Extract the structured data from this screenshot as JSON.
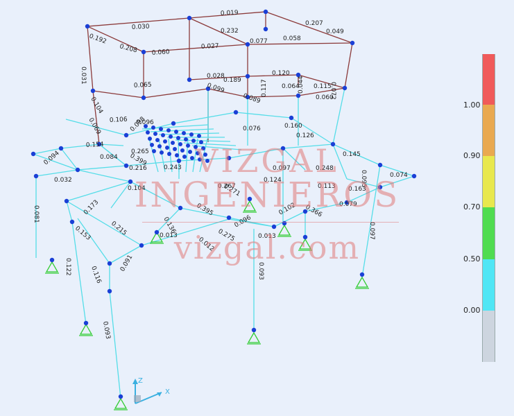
{
  "watermark": {
    "line1": "VIZGAL",
    "line2": "INGENIEROS",
    "line3": "vizgal.com"
  },
  "axes": {
    "z_label": "Z",
    "x_label": "X"
  },
  "legend": {
    "ticks": [
      "1.00",
      "0.90",
      "0.70",
      "0.50",
      "0.00"
    ],
    "band_colors": [
      "#f05a5a",
      "#e9a950",
      "#e8e84e",
      "#50dc50",
      "#4fe6f5",
      "#cdd5df"
    ]
  },
  "member_labels": [
    "0.030",
    "0.019",
    "0.192",
    "0.208",
    "0.060",
    "0.027",
    "0.232",
    "0.077",
    "0.058",
    "0.207",
    "0.049",
    "0.031",
    "0.065",
    "0.028",
    "0.099",
    "0.189",
    "0.089",
    "0.120",
    "0.064",
    "0.115",
    "0.072",
    "0.060",
    "0.117",
    "0.044",
    "0.104",
    "0.069",
    "0.106",
    "0.098",
    "0.096",
    "0.126",
    "0.154",
    "0.084",
    "0.216",
    "0.160",
    "0.097",
    "0.248",
    "0.145",
    "0.074",
    "0.104",
    "0.267",
    "0.124",
    "0.113",
    "0.163",
    "0.079",
    "0.095",
    "0.032",
    "0.094",
    "0.076",
    "0.173",
    "0.265",
    "0.399",
    "0.243",
    "0.271",
    "0.102",
    "0.366",
    "0.081",
    "0.215",
    "0.136",
    "0.395",
    "0.096",
    "0.012",
    "0.275",
    "0.013",
    "0.153",
    "0.013",
    "0.122",
    "0.116",
    "0.091",
    "0.093",
    "0.093",
    "0.097"
  ]
}
